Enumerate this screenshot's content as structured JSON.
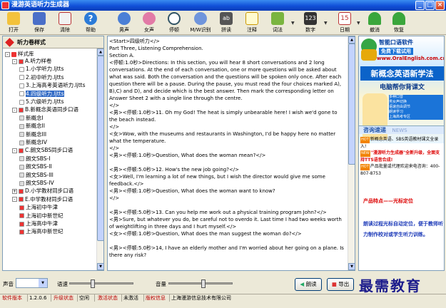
{
  "window": {
    "title": "漫游英语听力生成器"
  },
  "toolbar": {
    "open": "打开",
    "save": "保存",
    "clear": "清除",
    "help": "帮助",
    "male": "男声",
    "female": "女声",
    "pause": "停顿",
    "mw": "M/W识别",
    "spell": "拼读",
    "note": "注释",
    "vocab": "词法",
    "digit": "数字",
    "date": "日期",
    "undo": "撤消",
    "redo": "恢复"
  },
  "sidebar": {
    "title": "听力卷样式",
    "root": "样式库",
    "items": [
      "A.听力样卷",
      "1.小学听力.ljtts",
      "2.初中听力.ljtts",
      "3.上海高考英语听力.ljtts",
      "4.四级听力.ljtts",
      "5.六级听力.ljtts",
      "B.新概念英语同步口语",
      "新概念I",
      "新概念II",
      "新概念III",
      "新概念IV",
      "C.朗文SBS同步口语",
      "朗文SBS-I",
      "朗文SBS-II",
      "朗文SBS-III",
      "朗文SBS-IV",
      "D.小学教材同步口语",
      "E.中学教材同步口语",
      "上海初中牛津",
      "上海初中新世纪",
      "上海高中牛津",
      "上海高中新世纪"
    ]
  },
  "content": {
    "text": "<Start>四级听力</>\nPart Three, Listening Comprehension.\nSection A.\n<停顿:1.0秒>Directions: In this section, you will hear 8 short conversations and 2 long conversations. At the end of each conversation, one or more questions will be asked about what was said. Both the conversation and the questions will be spoken only once. After each question there will be a pause. During the pause, you must read the four choices marked A), B),C) and D), and decide which is the best answer. Then mark the corresponding letter on Answer Sheet 2 with a single line through the centre.\n</>\n<男><停顿:1.0秒>11. Oh my God! The heat is simply unbearable here! I wish we'd gone to the beach instead.\n</>\n<女>Wow, with the museums and restaurants in Washington, I'd be happy here no matter what the temperature.\n</>\n<男><停顿:1.0秒>Question, What does the woman mean?</>\n\n<男><停顿:5.0秒>12. How's the new job going?</>\n<女>Well, I'm learning a lot of new things, but I wish the director would give me some feedback.</>\n<男><停顿:1.0秒>Question, What does the woman want to know?\n</>\n\n<男><停顿:5.0秒>13. Can you help me work out a physical training program John?</>\n<男>Sure, but whatever you do, be careful not to overdo it. Last time I had two weeks worth of weightlifting in three days and I hurt myself.</>\n<女><停顿:1.0秒>Question, What does the man suggest the woman do?</>\n\n<男><停顿:5.0秒>14, I have an elderly mother and I'm worried about her going on a plane. Is there any risk?"
  },
  "ad": {
    "brand": "智能口语软件",
    "free": "免费下载试用",
    "url": "www.OralEnglish.com.cn",
    "banner": "新概念英语新学法",
    "tagline": "电脑帮你背课文",
    "features": [
      "多种口音",
      "男女声切换",
      "语速自由调节",
      "朗读学习",
      "上海高考专区"
    ],
    "news_title": "咨询速递",
    "news_en": "NEWS",
    "news": [
      {
        "hot": "HOT",
        "text": "新概念英语、SBS英语教材课文全录入!"
      },
      {
        "hot": "NEW",
        "text": "\"漫游听力生成器\"全新升级，全面支持TTS语音合成!"
      },
      {
        "hot": "HOT",
        "text": "产品批量或代理欢迎来电咨询：400-807-8753"
      }
    ],
    "promo_title": "产品特点——光标定位",
    "promo_text": "朗读过程光标自动定位，便于教师听力制作校对或学生听力训练。"
  },
  "controls": {
    "voice_label": "声音",
    "speed_label": "语速",
    "volume_label": "音量",
    "read_button": "朗读",
    "export_button": "导出",
    "speed_value": 0.35,
    "volume_value": 0.55
  },
  "status": {
    "version_label": "软件版本",
    "version": "1.2.0.6",
    "upgrade": "升级状态",
    "idle": "空闲",
    "activation": "激活状态",
    "not_activated": "未激活",
    "copyright": "版权信息",
    "company": "上海漫游信息技术有限公司"
  },
  "watermark": "最需教育"
}
